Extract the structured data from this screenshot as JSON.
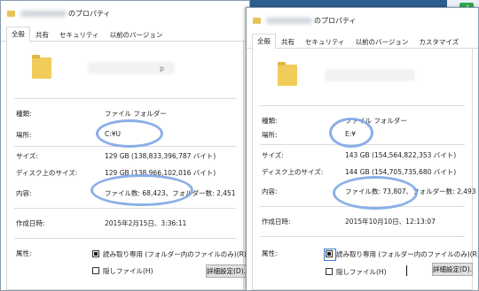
{
  "desktop": {
    "accent_glyph": "✓"
  },
  "left_window": {
    "title_suffix": "のプロパティ",
    "tabs": [
      {
        "label": "全般",
        "active": true
      },
      {
        "label": "共有",
        "active": false
      },
      {
        "label": "セキュリティ",
        "active": false
      },
      {
        "label": "以前のバージョン",
        "active": false
      }
    ],
    "folder_name_suffix": "p",
    "fields": {
      "type_label": "種類:",
      "type_value": "ファイル フォルダー",
      "location_label": "場所:",
      "location_value": "C:¥U",
      "size_label": "サイズ:",
      "size_value": "129 GB (138,833,396,787 バイト)",
      "disk_size_label": "ディスク上のサイズ:",
      "disk_size_value": "129 GB (138,966,102,016 バイト)",
      "contents_label": "内容:",
      "contents_value": "ファイル数: 68,423、フォルダー数: 2,451",
      "created_label": "作成日時:",
      "created_value": "2015年2月15日、3:36:11"
    },
    "attributes": {
      "label": "属性:",
      "readonly_label": "読み取り専用 (フォルダー内のファイルのみ)(R)",
      "readonly_checked": true,
      "hidden_label": "隠しファイル(H)",
      "hidden_checked": false,
      "advanced_button": "詳細設定(D)..."
    }
  },
  "right_window": {
    "title_suffix": "のプロパティ",
    "tabs": [
      {
        "label": "全般",
        "active": true
      },
      {
        "label": "共有",
        "active": false
      },
      {
        "label": "セキュリティ",
        "active": false
      },
      {
        "label": "以前のバージョン",
        "active": false
      },
      {
        "label": "カスタマイズ",
        "active": false
      }
    ],
    "fields": {
      "type_label": "種類:",
      "type_value": "ファイル フォルダー",
      "location_label": "場所:",
      "location_value": "E:¥",
      "size_label": "サイズ:",
      "size_value": "143 GB (154,564,822,353 バイト)",
      "disk_size_label": "ディスク上のサイズ:",
      "disk_size_value": "144 GB (154,705,735,680 バイト)",
      "contents_label": "内容:",
      "contents_value": "ファイル数: 73,807、フォルダー数: 2,493",
      "created_label": "作成日時:",
      "created_value": "2015年10月10日、12:13:07"
    },
    "attributes": {
      "label": "属性:",
      "readonly_label": "読み取り専用 (フォルダー内のファイルのみ)(R)",
      "readonly_checked": true,
      "hidden_label": "隠しファイル(H)",
      "hidden_checked": false,
      "advanced_button": "詳細設定(D)..."
    }
  },
  "colors": {
    "highlight_ring": "#7ea6e6",
    "folder": "#f2cc5b",
    "desktop": "#2d5f8e"
  }
}
